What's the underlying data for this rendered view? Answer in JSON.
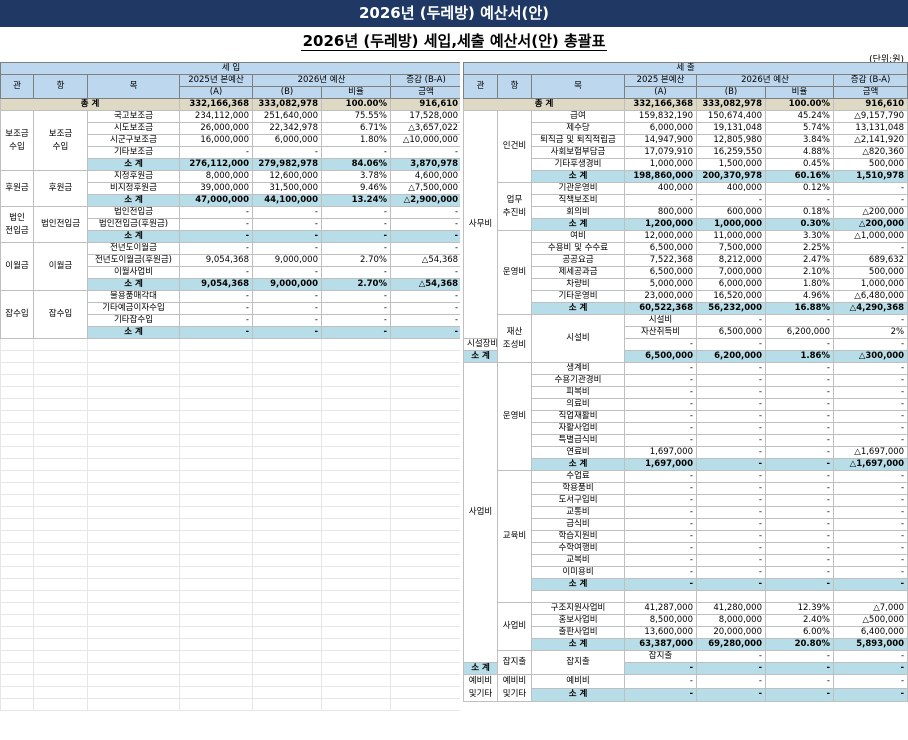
{
  "title": "2026년 (두레방) 예산서(안)",
  "subtitle": "2026년 (두레방) 세입,세출 예산서(안) 총괄표",
  "unit": "(단위:원)",
  "income": {
    "section_label": "세    입",
    "headers": {
      "gwan": "관",
      "hang": "항",
      "mok": "목",
      "prev": "2025년 본예산",
      "curr": "2026년 예산",
      "diff": "증감 (B-A)",
      "prev_sub": "(A)",
      "curr_sub": "(B)",
      "ratio": "비율",
      "amount": "금액"
    },
    "total": {
      "label": "총    계",
      "prev": "332,166,368",
      "curr": "333,082,978",
      "ratio": "100.00%",
      "diff": "916,610"
    },
    "rows": [
      {
        "gwan": "보조금\n수입",
        "hang": "보조금\n수입",
        "gspan": 5,
        "hspan": 5,
        "mok": "국고보조금",
        "prev": "234,112,000",
        "curr": "251,640,000",
        "ratio": "75.55%",
        "diff": "17,528,000"
      },
      {
        "mok": "시도보조금",
        "prev": "26,000,000",
        "curr": "22,342,978",
        "ratio": "6.71%",
        "diff": "△3,657,022"
      },
      {
        "mok": "시군구보조금",
        "prev": "16,000,000",
        "curr": "6,000,000",
        "ratio": "1.80%",
        "diff": "△10,000,000"
      },
      {
        "mok": "기타보조금",
        "prev": "-",
        "curr": "-",
        "ratio": "-",
        "diff": "-"
      },
      {
        "sub": true,
        "mok": "소  계",
        "prev": "276,112,000",
        "curr": "279,982,978",
        "ratio": "84.06%",
        "diff": "3,870,978"
      },
      {
        "gwan": "후원금",
        "hang": "후원금",
        "gspan": 3,
        "hspan": 3,
        "mok": "지정후원금",
        "prev": "8,000,000",
        "curr": "12,600,000",
        "ratio": "3.78%",
        "diff": "4,600,000"
      },
      {
        "mok": "비지정후원금",
        "prev": "39,000,000",
        "curr": "31,500,000",
        "ratio": "9.46%",
        "diff": "△7,500,000"
      },
      {
        "sub": true,
        "mok": "소  계",
        "prev": "47,000,000",
        "curr": "44,100,000",
        "ratio": "13.24%",
        "diff": "△2,900,000"
      },
      {
        "gwan": "법인\n전입금",
        "hang": "법인전입금",
        "gspan": 3,
        "hspan": 3,
        "mok": "법인전입금",
        "prev": "-",
        "curr": "-",
        "ratio": "-",
        "diff": "-"
      },
      {
        "mok": "법인전입금(후원금)",
        "prev": "-",
        "curr": "-",
        "ratio": "-",
        "diff": "-"
      },
      {
        "sub": true,
        "mok": "소  계",
        "prev": "-",
        "curr": "-",
        "ratio": "-",
        "diff": "-"
      },
      {
        "gwan": "이월금",
        "hang": "이월금",
        "gspan": 4,
        "hspan": 4,
        "mok": "전년도이월금",
        "prev": "-",
        "curr": "-",
        "ratio": "-",
        "diff": "-"
      },
      {
        "mok": "전년도이월금(후원금)",
        "prev": "9,054,368",
        "curr": "9,000,000",
        "ratio": "2.70%",
        "diff": "△54,368"
      },
      {
        "mok": "이월사업비",
        "prev": "-",
        "curr": "-",
        "ratio": "-",
        "diff": "-"
      },
      {
        "sub": true,
        "mok": "소  계",
        "prev": "9,054,368",
        "curr": "9,000,000",
        "ratio": "2.70%",
        "diff": "△54,368"
      },
      {
        "gwan": "잡수입",
        "hang": "잡수입",
        "gspan": 4,
        "hspan": 4,
        "mok": "불용품매각대",
        "prev": "-",
        "curr": "-",
        "ratio": "-",
        "diff": "-"
      },
      {
        "mok": "기타예금이자수입",
        "prev": "-",
        "curr": "-",
        "ratio": "-",
        "diff": "-"
      },
      {
        "mok": "기타잡수입",
        "prev": "-",
        "curr": "-",
        "ratio": "-",
        "diff": "-"
      },
      {
        "sub": true,
        "mok": "소  계",
        "prev": "-",
        "curr": "-",
        "ratio": "-",
        "diff": "-"
      }
    ]
  },
  "expense": {
    "section_label": "세    출",
    "headers": {
      "gwan": "관",
      "hang": "항",
      "mok": "목",
      "prev": "2025 본예산",
      "curr": "2026년 예산",
      "diff": "증감 (B-A)",
      "prev_sub": "(A)",
      "curr_sub": "(B)",
      "ratio": "비율",
      "amount": "금액"
    },
    "total": {
      "label": "총    계",
      "prev": "332,166,368",
      "curr": "333,082,978",
      "ratio": "100.00%",
      "diff": "916,610"
    },
    "rows": [
      {
        "gwan": "사무비",
        "gspan": 19,
        "hang": "인건비",
        "hspan": 6,
        "mok": "급여",
        "prev": "159,832,190",
        "curr": "150,674,400",
        "ratio": "45.24%",
        "diff": "△9,157,790"
      },
      {
        "mok": "제수당",
        "prev": "6,000,000",
        "curr": "19,131,048",
        "ratio": "5.74%",
        "diff": "13,131,048"
      },
      {
        "mok": "퇴직금 및 퇴직적립금",
        "prev": "14,947,900",
        "curr": "12,805,980",
        "ratio": "3.84%",
        "diff": "△2,141,920"
      },
      {
        "mok": "사회보험부담금",
        "prev": "17,079,910",
        "curr": "16,259,550",
        "ratio": "4.88%",
        "diff": "△820,360"
      },
      {
        "mok": "기타후생경비",
        "prev": "1,000,000",
        "curr": "1,500,000",
        "ratio": "0.45%",
        "diff": "500,000"
      },
      {
        "sub": true,
        "mok": "소  계",
        "prev": "198,860,000",
        "curr": "200,370,978",
        "ratio": "60.16%",
        "diff": "1,510,978"
      },
      {
        "hang": "업무\n추진비",
        "hspan": 4,
        "mok": "기관운영비",
        "prev": "400,000",
        "curr": "400,000",
        "ratio": "0.12%",
        "diff": "-"
      },
      {
        "mok": "직책보조비",
        "prev": "-",
        "curr": "-",
        "ratio": "-",
        "diff": "-"
      },
      {
        "mok": "회의비",
        "prev": "800,000",
        "curr": "600,000",
        "ratio": "0.18%",
        "diff": "△200,000"
      },
      {
        "sub": true,
        "mok": "소  계",
        "prev": "1,200,000",
        "curr": "1,000,000",
        "ratio": "0.30%",
        "diff": "△200,000"
      },
      {
        "hang": "운영비",
        "hspan": 7,
        "mok": "여비",
        "prev": "12,000,000",
        "curr": "11,000,000",
        "ratio": "3.30%",
        "diff": "△1,000,000"
      },
      {
        "mok": "수용비 및 수수료",
        "prev": "6,500,000",
        "curr": "7,500,000",
        "ratio": "2.25%",
        "diff": "-"
      },
      {
        "mok": "공공요금",
        "prev": "7,522,368",
        "curr": "8,212,000",
        "ratio": "2.47%",
        "diff": "689,632"
      },
      {
        "mok": "제세공과금",
        "prev": "6,500,000",
        "curr": "7,000,000",
        "ratio": "2.10%",
        "diff": "500,000"
      },
      {
        "mok": "차량비",
        "prev": "5,000,000",
        "curr": "6,000,000",
        "ratio": "1.80%",
        "diff": "1,000,000"
      },
      {
        "mok": "기타운영비",
        "prev": "23,000,000",
        "curr": "16,520,000",
        "ratio": "4.96%",
        "diff": "△6,480,000"
      },
      {
        "sub": true,
        "mok": "소  계",
        "prev": "60,522,368",
        "curr": "56,232,000",
        "ratio": "16.88%",
        "diff": "△4,290,368"
      },
      {
        "gwan": "재산\n조성비",
        "gspan": 4,
        "hang": "시설비",
        "hspan": 4,
        "mok": "시설비",
        "prev": "-",
        "curr": "-",
        "ratio": "-",
        "diff": "-"
      },
      {
        "mok": "자산취득비",
        "prev": "6,500,000",
        "curr": "6,200,000",
        "ratio": "2%",
        "diff": "△300,000"
      },
      {
        "mok": "시설장비유지비",
        "prev": "-",
        "curr": "-",
        "ratio": "-",
        "diff": "-"
      },
      {
        "sub": true,
        "mok": "소  계",
        "prev": "6,500,000",
        "curr": "6,200,000",
        "ratio": "1.86%",
        "diff": "△300,000"
      },
      {
        "gwan": "사업비",
        "gspan": 25,
        "hang": "운영비",
        "hspan": 9,
        "mok": "생계비",
        "prev": "-",
        "curr": "-",
        "ratio": "-",
        "diff": "-"
      },
      {
        "mok": "수용기관경비",
        "prev": "-",
        "curr": "-",
        "ratio": "-",
        "diff": "-"
      },
      {
        "mok": "피복비",
        "prev": "-",
        "curr": "-",
        "ratio": "-",
        "diff": "-"
      },
      {
        "mok": "의료비",
        "prev": "-",
        "curr": "-",
        "ratio": "-",
        "diff": "-"
      },
      {
        "mok": "직업재활비",
        "prev": "-",
        "curr": "-",
        "ratio": "-",
        "diff": "-"
      },
      {
        "mok": "자활사업비",
        "prev": "-",
        "curr": "-",
        "ratio": "-",
        "diff": "-"
      },
      {
        "mok": "특별급식비",
        "prev": "-",
        "curr": "-",
        "ratio": "-",
        "diff": "-"
      },
      {
        "mok": "연료비",
        "prev": "1,697,000",
        "curr": "-",
        "ratio": "-",
        "diff": "△1,697,000"
      },
      {
        "sub": true,
        "mok": "소  계",
        "prev": "1,697,000",
        "curr": "-",
        "ratio": "-",
        "diff": "△1,697,000"
      },
      {
        "hang": "교육비",
        "hspan": 11,
        "mok": "수업료",
        "prev": "-",
        "curr": "-",
        "ratio": "-",
        "diff": "-"
      },
      {
        "mok": "학용품비",
        "prev": "-",
        "curr": "-",
        "ratio": "-",
        "diff": "-"
      },
      {
        "mok": "도서구입비",
        "prev": "-",
        "curr": "-",
        "ratio": "-",
        "diff": "-"
      },
      {
        "mok": "교통비",
        "prev": "-",
        "curr": "-",
        "ratio": "-",
        "diff": "-"
      },
      {
        "mok": "급식비",
        "prev": "-",
        "curr": "-",
        "ratio": "-",
        "diff": "-"
      },
      {
        "mok": "학습지원비",
        "prev": "-",
        "curr": "-",
        "ratio": "-",
        "diff": "-"
      },
      {
        "mok": "수학여행비",
        "prev": "-",
        "curr": "-",
        "ratio": "-",
        "diff": "-"
      },
      {
        "mok": "교복비",
        "prev": "-",
        "curr": "-",
        "ratio": "-",
        "diff": "-"
      },
      {
        "mok": "이미용비",
        "prev": "-",
        "curr": "-",
        "ratio": "-",
        "diff": "-"
      },
      {
        "sub": true,
        "mok": "소  계",
        "prev": "-",
        "curr": "-",
        "ratio": "-",
        "diff": "-"
      },
      {
        "mok": "",
        "prev": "",
        "curr": "",
        "ratio": "",
        "diff": ""
      },
      {
        "hang": "사업비",
        "hspan": 4,
        "mok": "구조지원사업비",
        "prev": "41,287,000",
        "curr": "41,280,000",
        "ratio": "12.39%",
        "diff": "△7,000"
      },
      {
        "mok": "홍보사업비",
        "prev": "8,500,000",
        "curr": "8,000,000",
        "ratio": "2.40%",
        "diff": "△500,000"
      },
      {
        "mok": "출판사업비",
        "prev": "13,600,000",
        "curr": "20,000,000",
        "ratio": "6.00%",
        "diff": "6,400,000"
      },
      {
        "sub": true,
        "mok": "소  계",
        "prev": "63,387,000",
        "curr": "69,280,000",
        "ratio": "20.80%",
        "diff": "5,893,000"
      },
      {
        "gwan": "잡지출",
        "gspan": 2,
        "hang": "잡지출",
        "hspan": 2,
        "mok": "잡지출",
        "prev": "-",
        "curr": "-",
        "ratio": "-",
        "diff": "-"
      },
      {
        "sub": true,
        "mok": "소  계",
        "prev": "-",
        "curr": "-",
        "ratio": "-",
        "diff": "-"
      },
      {
        "gwan": "예비비\n및기타",
        "gspan": 2,
        "hang": "예비비\n및기타",
        "hspan": 2,
        "mok": "예비비",
        "prev": "-",
        "curr": "-",
        "ratio": "-",
        "diff": "-"
      },
      {
        "sub": true,
        "mok": "소  계",
        "prev": "-",
        "curr": "-",
        "ratio": "-",
        "diff": "-"
      }
    ]
  }
}
